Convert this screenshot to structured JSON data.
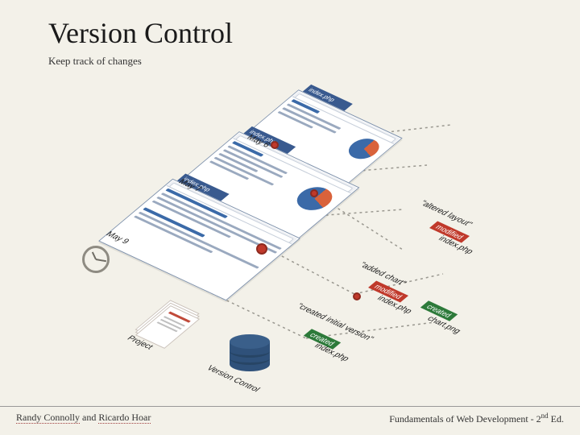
{
  "header": {
    "title": "Version Control",
    "subtitle": "Keep track of changes"
  },
  "diagram": {
    "filename": "index.php",
    "project_label": "Project",
    "vcs_label": "Version Control",
    "dates": {
      "may6": "May 6",
      "may7": "May 7",
      "may9": "May 9"
    },
    "commits": [
      {
        "message": "\"created initial version\"",
        "badge_type": "created",
        "badge_text": "created",
        "file": "index.php"
      },
      {
        "message": "\"added chart\"",
        "badge_type": "modified",
        "badge_text": "modified",
        "file": "index.php"
      },
      {
        "message": "\"altered layout\"",
        "badge_type": "modified",
        "badge_text": "modified",
        "file": "index.php"
      },
      {
        "message": "",
        "badge_type": "created",
        "badge_text": "created",
        "file": "chart.png"
      }
    ]
  },
  "footer": {
    "author1": "Randy Connolly",
    "joiner": " and ",
    "author2": "Ricardo Hoar",
    "book": "Fundamentals of Web Development - 2",
    "ed": "nd",
    "ed_suffix": " Ed."
  }
}
